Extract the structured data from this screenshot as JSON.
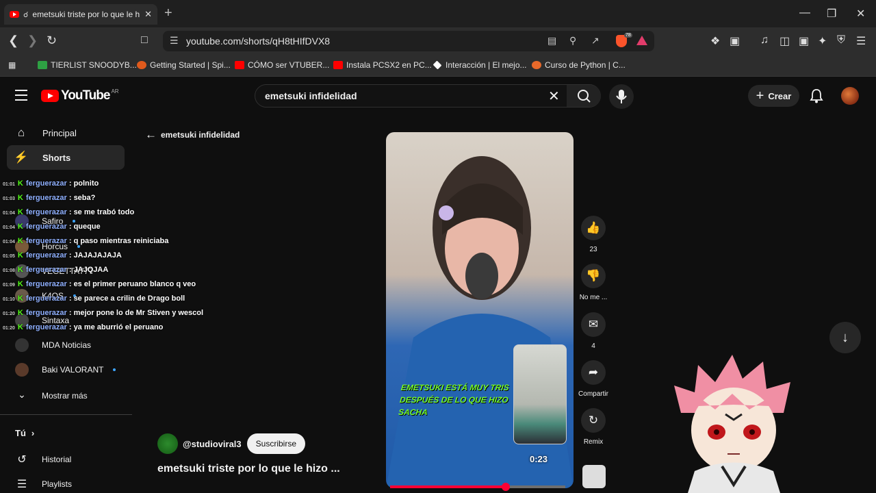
{
  "browser": {
    "tab_title": "emetsuki triste por lo que le h",
    "url": "youtube.com/shorts/qH8tHIfDVX8",
    "brave_count": "78",
    "bookmarks": [
      "TIERLIST SNOODYB...",
      "Getting Started | Spi...",
      "CÓMO ser VTUBER...",
      "Instala PCSX2 en PC...",
      "Interacción | El mejo...",
      "Curso de Python | C..."
    ]
  },
  "youtube": {
    "logo_text": "YouTube",
    "country": "AR",
    "search_value": "emetsuki infidelidad",
    "create_label": "Crear"
  },
  "sidebar": {
    "principal": "Principal",
    "shorts": "Shorts",
    "channels": [
      "Safiro",
      "Horcus",
      "VEGETTA777",
      "K4OS",
      "Sintaxa",
      "MDA Noticias",
      "Baki VALORANT"
    ],
    "show_more": "Mostrar más",
    "you": "Tú",
    "history": "Historial",
    "playlists": "Playlists"
  },
  "chat": [
    {
      "time": "01:01",
      "user": "ferguerazar",
      "text": ": polnito"
    },
    {
      "time": "01:03",
      "user": "ferguerazar",
      "text": ": seba?"
    },
    {
      "time": "01:04",
      "user": "ferguerazar",
      "text": ": se me trabó todo"
    },
    {
      "time": "01:04",
      "user": "ferguerazar",
      "text": ": queque"
    },
    {
      "time": "01:04",
      "user": "ferguerazar",
      "text": ": q paso mientras reiniciaba"
    },
    {
      "time": "01:05",
      "user": "ferguerazar",
      "text": ": JAJAJAJAJA"
    },
    {
      "time": "01:08",
      "user": "ferguerazar",
      "text": ": JAJQJAA"
    },
    {
      "time": "01:09",
      "user": "ferguerazar",
      "text": ": es el primer peruano blanco q veo"
    },
    {
      "time": "01:10",
      "user": "ferguerazar",
      "text": ": se parece a crilin de Drago boll"
    },
    {
      "time": "01:20",
      "user": "ferguerazar",
      "text": ": mejor pone lo de Mr Stiven y wescol"
    },
    {
      "time": "01:20",
      "user": "ferguerazar",
      "text": ": ya me aburrió el peruano"
    }
  ],
  "shorts": {
    "back_label": "emetsuki infidelidad",
    "caption_line1": "EMETSUKI ESTÁ MUY TRIS",
    "caption_line2": "DESPUÉS DE LO QUE HIZO SACHA",
    "timer": "0:23",
    "progress": 0.66,
    "likes": "23",
    "dislike_label": "No me ...",
    "comments": "4",
    "share_label": "Compartir",
    "remix_label": "Remix",
    "channel": "@studioviral3",
    "subscribe": "Suscribirse",
    "title": "emetsuki triste por lo que le hizo ..."
  },
  "colors": {
    "accent": "#ff0033",
    "kick": "#53fc18",
    "caption": "#73f72d"
  }
}
